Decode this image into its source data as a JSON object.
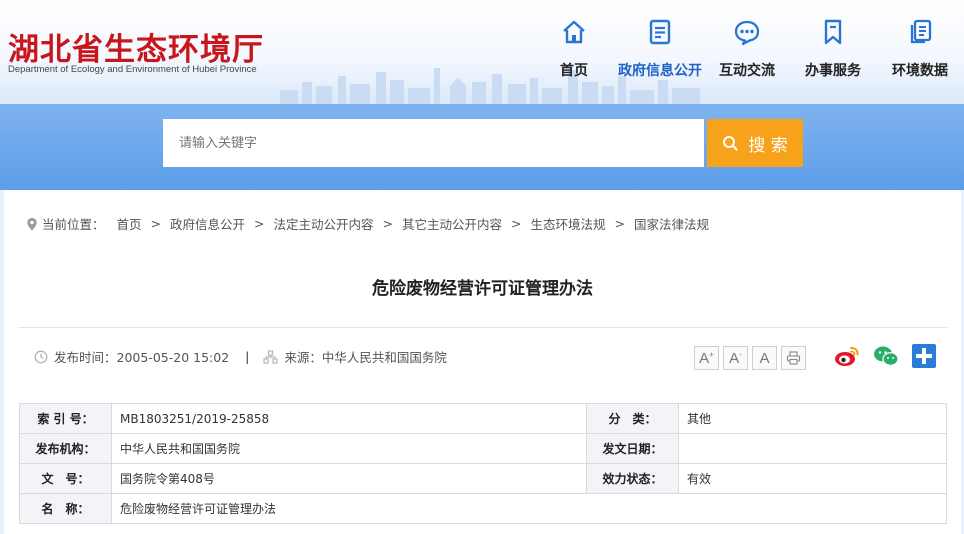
{
  "site": {
    "name_cn": "湖北省生态环境厅",
    "name_en": "Department of Ecology and Environment of Hubei Province"
  },
  "nav": {
    "items": [
      {
        "label": "首页",
        "icon": "home-icon"
      },
      {
        "label": "政府信息公开",
        "icon": "document-icon",
        "active": true
      },
      {
        "label": "互动交流",
        "icon": "chat-bubble-icon"
      },
      {
        "label": "办事服务",
        "icon": "bookmark-icon"
      },
      {
        "label": "环境数据",
        "icon": "data-copy-icon"
      }
    ]
  },
  "search": {
    "placeholder": "请输入关键字",
    "button_label": "搜 索"
  },
  "breadcrumb": {
    "prefix": "当前位置：",
    "items": [
      "首页",
      "政府信息公开",
      "法定主动公开内容",
      "其它主动公开内容",
      "生态环境法规",
      "国家法律法规"
    ]
  },
  "article": {
    "title": "危险废物经营许可证管理办法",
    "publish_time": "发布时间：2005-05-20 15:02",
    "source": "来源：中华人民共和国国务院"
  },
  "tools": {
    "font_large": "A",
    "font_medium": "A",
    "font_small": "A",
    "font_large_sup": "+",
    "font_medium_sup": "-"
  },
  "info_table": {
    "index_label": "索 引 号：",
    "index_value": "MB1803251/2019-25858",
    "category_label": "分　类：",
    "category_value": "其他",
    "issuer_label": "发布机构：",
    "issuer_value": "中华人民共和国国务院",
    "date_label": "发文日期：",
    "date_value": "",
    "doc_no_label": "文　号：",
    "doc_no_value": "国务院令第408号",
    "status_label": "效力状态：",
    "status_value": "有效",
    "name_label": "名　称：",
    "name_value": "危险废物经营许可证管理办法"
  },
  "colors": {
    "brand_red": "#c8161d",
    "nav_active": "#1e62c8",
    "icon_blue": "#2b74d6",
    "search_orange": "#f7a21b",
    "band_blue": "#6aa7ec",
    "weibo_red": "#e6162d",
    "wechat_green": "#2aae67",
    "plus_blue": "#2b7cd9"
  }
}
